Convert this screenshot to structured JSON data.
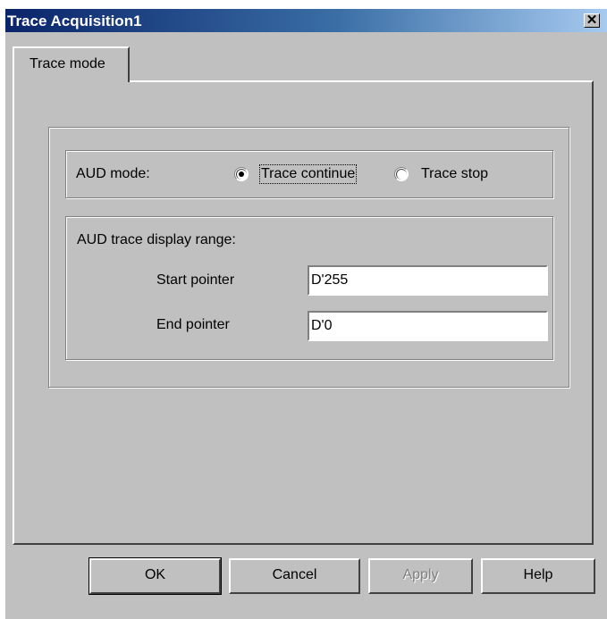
{
  "window": {
    "title": "Trace Acquisition1",
    "close_glyph": "✕"
  },
  "tabs": [
    {
      "label": "Trace mode",
      "selected": true
    }
  ],
  "aud_mode": {
    "label": "AUD mode:",
    "options": [
      {
        "label": "Trace continue",
        "selected": true
      },
      {
        "label": "Trace stop",
        "selected": false
      }
    ]
  },
  "display_range": {
    "label": "AUD trace display range:",
    "start_pointer": {
      "label": "Start pointer",
      "value": "D'255"
    },
    "end_pointer": {
      "label": "End pointer",
      "value": "D'0"
    }
  },
  "buttons": {
    "ok": "OK",
    "cancel": "Cancel",
    "apply": "Apply",
    "help": "Help"
  },
  "colors": {
    "face": "#c0c0c0",
    "title_start": "#0a246a",
    "title_end": "#a6caf0"
  }
}
